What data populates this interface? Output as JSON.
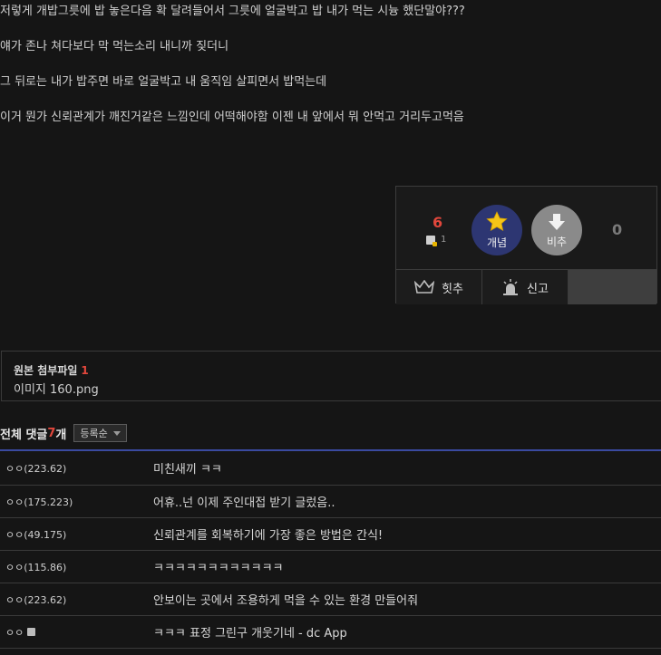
{
  "post": {
    "lines": [
      "저렇게 개밥그릇에 밥 놓은다음 확 달려들어서 그릇에 얼굴박고 밥 내가 먹는 시늉 했단말야???",
      "얘가 존나 쳐다보다 막 먹는소리 내니까 짖더니",
      "그 뒤로는 내가 밥주면 바로 얼굴박고 내 움직임 살피면서 밥먹는데",
      "이거 뭔가 신뢰관계가 깨진거같은 느낌인데 어떡해야함 이젠 내 앞에서 뭐 안먹고 거리두고먹음"
    ]
  },
  "vote": {
    "up_count": "6",
    "fix_count": "1",
    "up_label": "개념",
    "down_label": "비추",
    "down_count": "0",
    "hit_label": "힛추",
    "report_label": "신고",
    "colors": {
      "up": "#2d3672",
      "down": "#8a8a8a",
      "count": "#e2473c"
    }
  },
  "attachment": {
    "title": "원본 첨부파일",
    "count": "1",
    "filename": "이미지 160.png"
  },
  "comments": {
    "label": "전체 댓글",
    "count": "7",
    "unit": "개",
    "sort": "등록순",
    "items": [
      {
        "nick": "ㅇㅇ(223.62)",
        "text": "미친새끼 ㅋㅋ"
      },
      {
        "nick": "ㅇㅇ(175.223)",
        "text": "어휴..넌 이제 주인대접 받기 글렀음.."
      },
      {
        "nick": "ㅇㅇ(49.175)",
        "text": "신뢰관계를 회복하기에 가장 좋은 방법은 간식!"
      },
      {
        "nick": "ㅇㅇ(115.86)",
        "text": "ㅋㅋㅋㅋㅋㅋㅋㅋㅋㅋㅋㅋ"
      },
      {
        "nick": "ㅇㅇ(223.62)",
        "text": "안보이는 곳에서 조용하게 먹을 수 있는 환경 만들어줘"
      },
      {
        "nick": "ㅇㅇ",
        "text": "ㅋㅋㅋ 표정 그린구 개웃기네 - dc App"
      }
    ]
  }
}
